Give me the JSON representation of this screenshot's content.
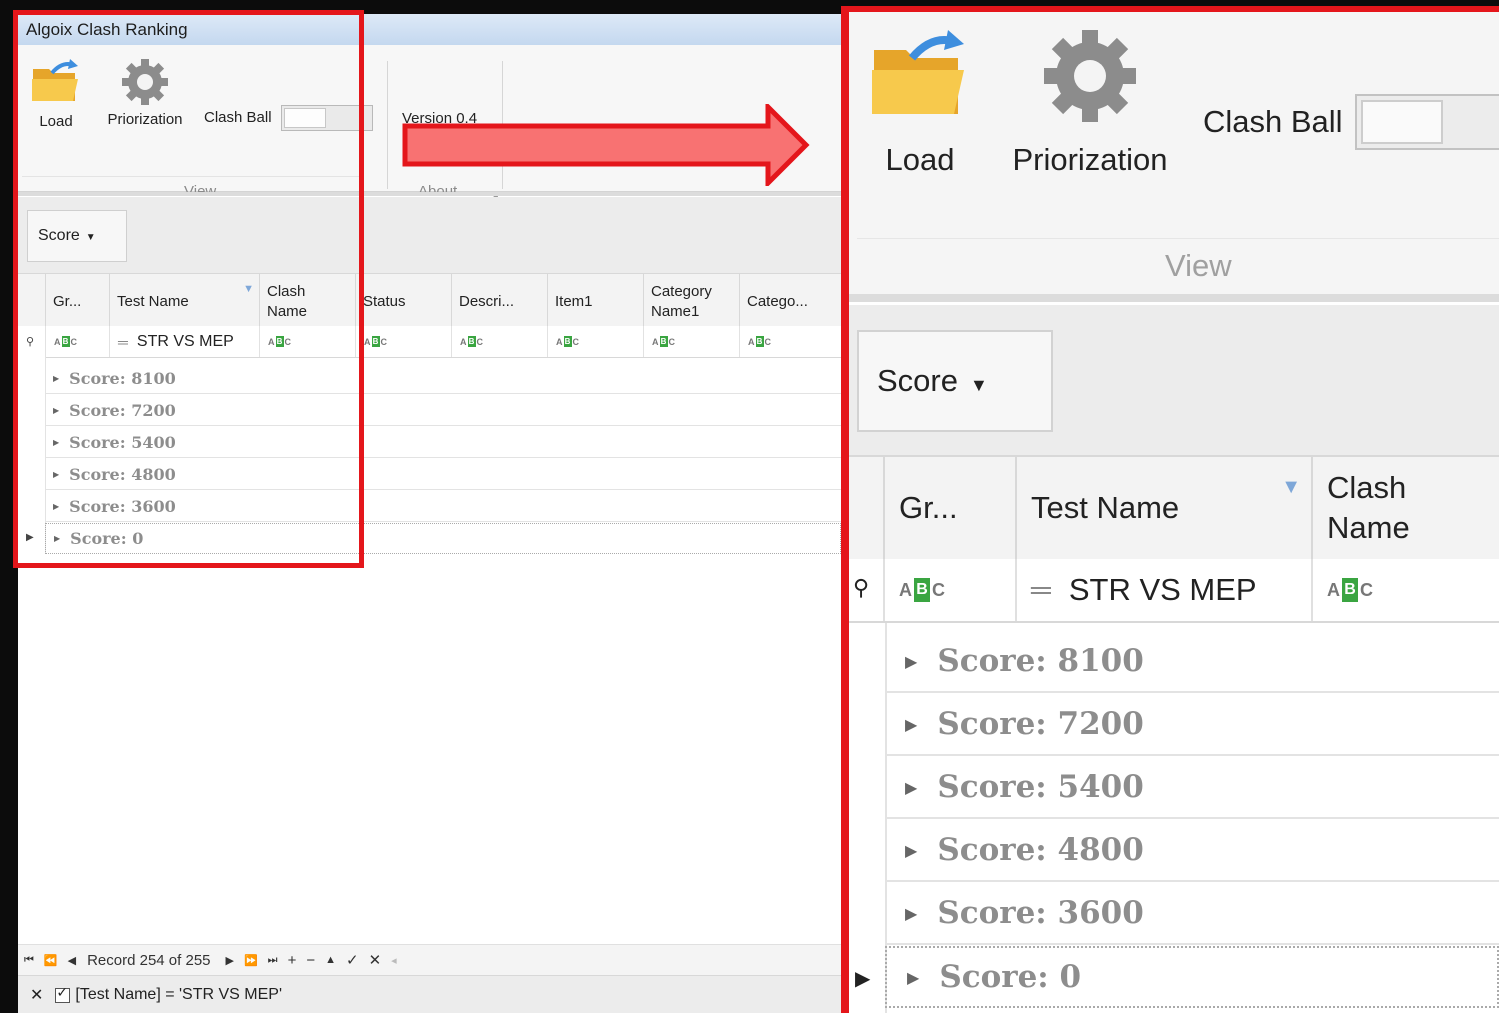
{
  "window": {
    "title": "Algoix Clash Ranking"
  },
  "ribbon": {
    "load_label": "Load",
    "priorization_label": "Priorization",
    "clash_ball_label": "Clash Ball",
    "version_label": "Version 0.4",
    "group_view": "View",
    "group_about": "About"
  },
  "grouping": {
    "chip_label": "Score"
  },
  "grid": {
    "columns": [
      "Gr...",
      "Test Name",
      "Clash Name",
      "Status",
      "Descri...",
      "Item1",
      "Category Name1",
      "Catego..."
    ],
    "filter_row": {
      "test_name_value": "STR VS MEP",
      "operator_icon": "equals-icon",
      "text_filter_icon": "abc-text-filter-icon"
    },
    "groups": [
      "Score: 8100",
      "Score: 7200",
      "Score: 5400",
      "Score: 4800",
      "Score: 3600",
      "Score: 0"
    ]
  },
  "navigator": {
    "record_text": "Record 254 of 255"
  },
  "filter_bar": {
    "expression": "[Test Name] = 'STR VS MEP'"
  },
  "colors": {
    "highlight": "#e4161b",
    "arrow_fill": "#f87272",
    "abc_green": "#3aa541"
  }
}
